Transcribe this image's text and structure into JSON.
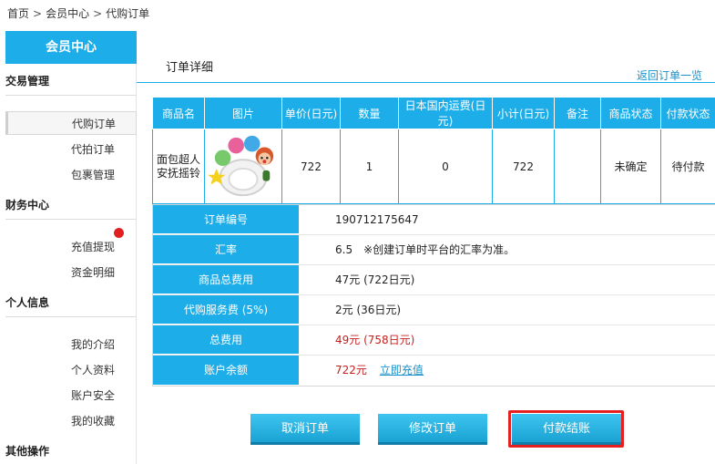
{
  "breadcrumb": {
    "home": "首页",
    "member": "会员中心",
    "current": "代购订单",
    "separator": ">"
  },
  "sidebar": {
    "header": "会员中心",
    "groups": [
      {
        "title": "交易管理",
        "items": [
          "代购订单",
          "代拍订单",
          "包裹管理"
        ]
      },
      {
        "title": "财务中心",
        "items": [
          "充值提现",
          "资金明细"
        ]
      },
      {
        "title": "个人信息",
        "items": [
          "我的介绍",
          "个人资料",
          "账户安全",
          "我的收藏"
        ]
      },
      {
        "title": "其他操作",
        "items": []
      }
    ],
    "active_item": "代购订单"
  },
  "main": {
    "tab": "订单详细",
    "back_link": "返回订单一览",
    "table": {
      "headers": [
        "商品名",
        "图片",
        "单价(日元)",
        "数量",
        "日本国内运费(日元)",
        "小计(日元)",
        "备注",
        "商品状态",
        "付款状态"
      ],
      "row": {
        "name": "面包超人安抚摇铃",
        "image": "toy-rattle-image",
        "unit_price": "722",
        "quantity": "1",
        "shipping": "0",
        "subtotal": "722",
        "remark": "",
        "item_status": "未确定",
        "pay_status": "待付款"
      }
    },
    "info": {
      "order_no_label": "订单编号",
      "order_no": "190712175647",
      "rate_label": "汇率",
      "rate": "6.5",
      "rate_note": "※创建订单时平台的汇率为准。",
      "goods_total_label": "商品总费用",
      "goods_total": "47元 (722日元)",
      "service_fee_label": "代购服务费 (5%)",
      "service_fee": "2元 (36日元)",
      "total_label": "总费用",
      "total": "49元 (758日元)",
      "balance_label": "账户余额",
      "balance": "722元",
      "recharge_link": "立即充值"
    },
    "buttons": {
      "cancel": "取消订单",
      "modify": "修改订单",
      "pay": "付款结账"
    }
  },
  "colors": {
    "accent": "#1daee9",
    "alert": "#c81d1d",
    "highlight": "#e52020"
  }
}
